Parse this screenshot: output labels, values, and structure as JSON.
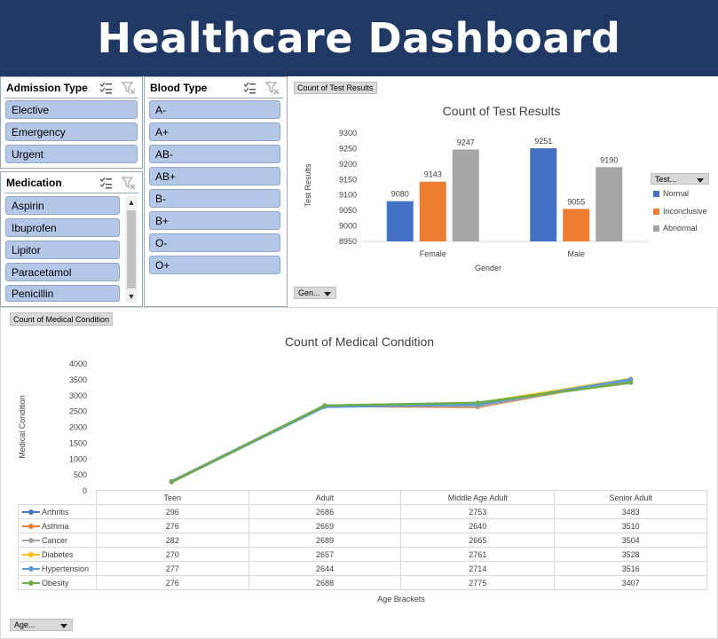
{
  "app_title": "Healthcare Dashboard",
  "slicers": {
    "admission_type": {
      "title": "Admission Type",
      "items": [
        "Elective",
        "Emergency",
        "Urgent"
      ]
    },
    "medication": {
      "title": "Medication",
      "items": [
        "Aspirin",
        "Ibuprofen",
        "Lipitor",
        "Paracetamol",
        "Penicillin"
      ]
    },
    "blood_type": {
      "title": "Blood Type",
      "items": [
        "A-",
        "A+",
        "AB-",
        "AB+",
        "B-",
        "B+",
        "O-",
        "O+"
      ]
    }
  },
  "icons": {
    "multi_select": "multi-select-icon",
    "clear_filter": "clear-filter-icon"
  },
  "test_results_panel": {
    "field_button": "Count of Test Results",
    "legend_filter_button": "Test...",
    "axis_filter_button": "Gen..."
  },
  "medical_panel": {
    "field_button": "Count of Medical Condition",
    "axis_filter_button": "Age..."
  },
  "colors": {
    "banner": "#1f3864",
    "slicer_item": "#b4c7e7",
    "normal": "#4472c4",
    "inconclusive": "#ed7d31",
    "abnormal": "#a5a5a5"
  },
  "chart_data": [
    {
      "type": "bar",
      "title": "Count of Test Results",
      "xlabel": "Gender",
      "ylabel": "Test Results",
      "categories": [
        "Female",
        "Male"
      ],
      "ylim": [
        8950,
        9300
      ],
      "yticks": [
        8950,
        9000,
        9050,
        9100,
        9150,
        9200,
        9250,
        9300
      ],
      "grid": false,
      "legend_position": "right",
      "series": [
        {
          "name": "Normal",
          "values": [
            9080,
            9251
          ],
          "color": "#4472c4"
        },
        {
          "name": "Inconclusive",
          "values": [
            9143,
            9055
          ],
          "color": "#ed7d31"
        },
        {
          "name": "Abnormal",
          "values": [
            9247,
            9190
          ],
          "color": "#a5a5a5"
        }
      ]
    },
    {
      "type": "line",
      "title": "Count of Medical Condition",
      "xlabel": "Age Brackets",
      "ylabel": "Medical Condition",
      "categories": [
        "Teen",
        "Adult",
        "Middle Age Adult",
        "Senior Adult"
      ],
      "ylim": [
        0,
        4000
      ],
      "yticks": [
        0,
        500,
        1000,
        1500,
        2000,
        2500,
        3000,
        3500,
        4000
      ],
      "grid": false,
      "legend_position": "data table",
      "series": [
        {
          "name": "Arthritis",
          "values": [
            296,
            2686,
            2753,
            3483
          ],
          "color": "#4472c4"
        },
        {
          "name": "Asthma",
          "values": [
            276,
            2669,
            2640,
            3510
          ],
          "color": "#ed7d31"
        },
        {
          "name": "Cancer",
          "values": [
            282,
            2689,
            2665,
            3504
          ],
          "color": "#a5a5a5"
        },
        {
          "name": "Diabetes",
          "values": [
            270,
            2657,
            2761,
            3528
          ],
          "color": "#ffc000"
        },
        {
          "name": "Hypertension",
          "values": [
            277,
            2644,
            2714,
            3516
          ],
          "color": "#5b9bd5"
        },
        {
          "name": "Obesity",
          "values": [
            276,
            2688,
            2775,
            3407
          ],
          "color": "#70ad47"
        }
      ]
    }
  ]
}
